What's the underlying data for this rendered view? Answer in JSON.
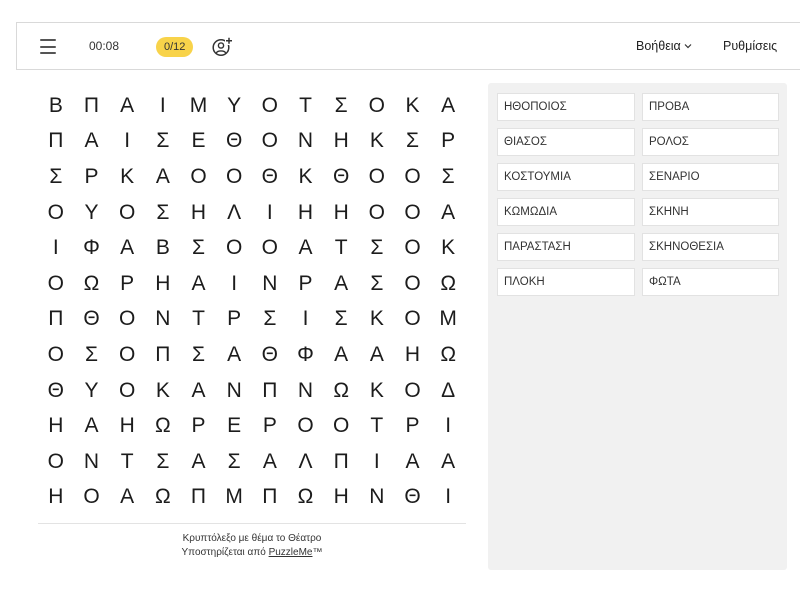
{
  "toolbar": {
    "timer": "00:08",
    "progress": "0/12",
    "help_label": "Βοήθεια",
    "settings_label": "Ρυθμίσεις",
    "icons": {
      "menu": "menu-icon",
      "add_user": "add-user-icon",
      "chevron": "chevron-down-icon"
    },
    "colors": {
      "progress_badge": "#f8d34a"
    }
  },
  "grid": {
    "rows": [
      "ΒΠΑΙΜΥΟΤΣΟΚΑ",
      "ΠΑΙΣΕΘΟΝΗΚΣΡ",
      "ΣΡΚΑΟΟΘΚΘΟΟΣ",
      "ΟΥΟΣΗΛΙΗΗΟΟΑ",
      "ΙΦΑΒΣΟΟΑΤΣΟΚ",
      "ΟΩΡΗΑΙΝΡΑΣΟΩ",
      "ΠΘΟΝΤΡΣΙΣΚΟΜ",
      "ΟΣΟΠΣΑΘΦΑΑΗΩ",
      "ΘΥΟΚΑΝΠΝΩΚΟΔ",
      "ΗΑΗΩΡΕΡΟΟΤΡΙ",
      "ΟΝΤΣΑΣΑΛΠΙΑΑ",
      "ΗΟΑΩΠΜΠΩΗΝΘΙ"
    ]
  },
  "footer": {
    "line1": "Κρυπτόλεξο με θέμα το Θέατρο",
    "line2_prefix": "Υποστηρίζεται από ",
    "link": "PuzzleMe",
    "tm": "™"
  },
  "words": [
    "ΗΘΟΠΟΙΟΣ",
    "ΠΡΟΒΑ",
    "ΘΙΑΣΟΣ",
    "ΡΟΛΟΣ",
    "ΚΟΣΤΟΥΜΙΑ",
    "ΣΕΝΑΡΙΟ",
    "ΚΩΜΩΔΙΑ",
    "ΣΚΗΝΗ",
    "ΠΑΡΑΣΤΑΣΗ",
    "ΣΚΗΝΟΘΕΣΙΑ",
    "ΠΛΟΚΗ",
    "ΦΩΤΑ"
  ]
}
